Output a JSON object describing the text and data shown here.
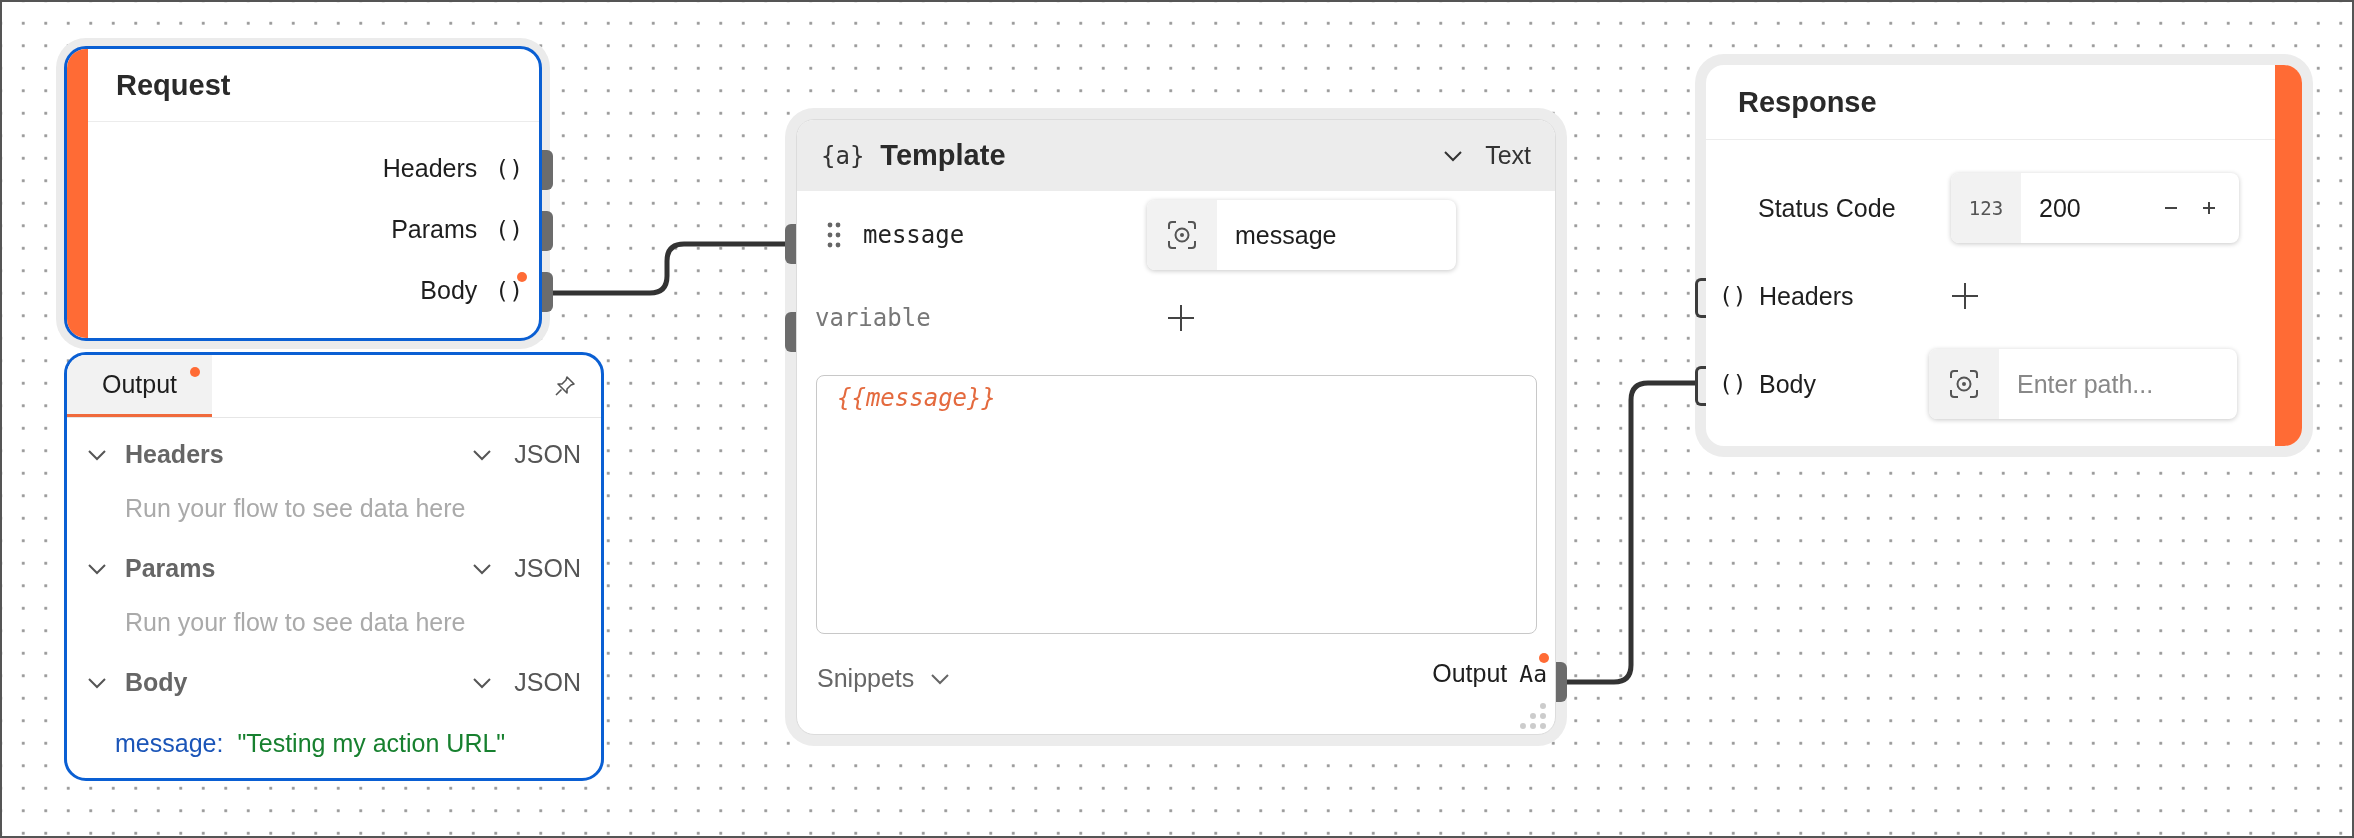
{
  "request_node": {
    "title": "Request",
    "outputs": [
      {
        "label": "Headers",
        "type_icon": "()"
      },
      {
        "label": "Params",
        "type_icon": "()"
      },
      {
        "label": "Body",
        "type_icon": "()",
        "has_data": true
      }
    ]
  },
  "output_panel": {
    "tabs": [
      {
        "label": "Output",
        "selected": true,
        "has_data": true
      }
    ],
    "sections": [
      {
        "title": "Headers",
        "format": "JSON",
        "expanded": true,
        "empty_message": "Run your flow to see data here"
      },
      {
        "title": "Params",
        "format": "JSON",
        "expanded": true,
        "empty_message": "Run your flow to see data here"
      },
      {
        "title": "Body",
        "format": "JSON",
        "expanded": true,
        "fields": [
          {
            "key": "message:",
            "value": "\"Testing my action URL\""
          }
        ]
      }
    ]
  },
  "template_node": {
    "icon": "{a}",
    "title": "Template",
    "output_format": "Text",
    "variables": [
      {
        "name": "message",
        "source": "message"
      }
    ],
    "new_variable_placeholder": "variable",
    "template_text": "{{message}}",
    "snippets_label": "Snippets",
    "output": {
      "label": "Output",
      "type_icon": "Aa",
      "has_data": true
    }
  },
  "response_node": {
    "title": "Response",
    "fields": [
      {
        "kind": "number",
        "label": "Status Code",
        "type_icon": "123",
        "value": "200"
      },
      {
        "kind": "add",
        "label": "Headers",
        "type_icon": "()"
      },
      {
        "kind": "path",
        "label": "Body",
        "type_icon": "()",
        "placeholder": "Enter path..."
      }
    ]
  }
}
